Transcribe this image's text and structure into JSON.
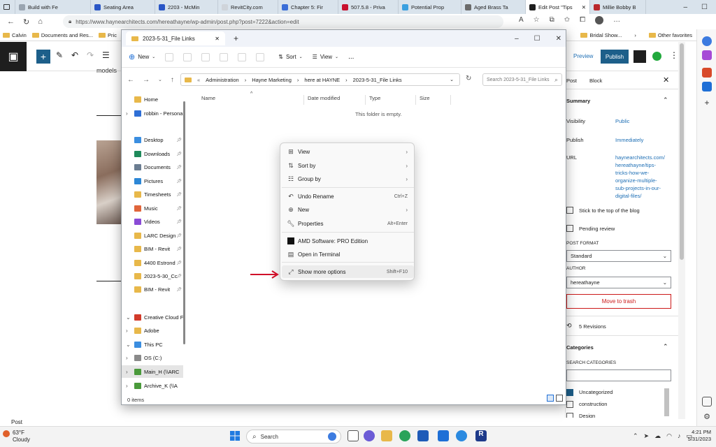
{
  "browser": {
    "tabs": [
      {
        "label": "Build with Fe",
        "color": "#9aa5b1",
        "active": false
      },
      {
        "label": "Seating Area",
        "color": "#2a56c6",
        "active": false
      },
      {
        "label": "2203 - McMin",
        "color": "#2a56c6",
        "active": false
      },
      {
        "label": "RevitCity.com",
        "color": "#cfd4da",
        "active": false
      },
      {
        "label": "Chapter 5: Fir",
        "color": "#3a6ed8",
        "active": false
      },
      {
        "label": "507.5.8 - Priva",
        "color": "#c8102e",
        "active": false
      },
      {
        "label": "Potential Prop",
        "color": "#3aa0e0",
        "active": false
      },
      {
        "label": "Aged Brass Ta",
        "color": "#6b6b6b",
        "active": false
      },
      {
        "label": "Edit Post \"Tips",
        "color": "#1e1e1e",
        "active": true
      },
      {
        "label": "Millie Bobby B",
        "color": "#b9272c",
        "active": false
      }
    ],
    "url": "https://www.haynearchitects.com/hereathayne/wp-admin/post.php?post=7222&action=edit",
    "favorites": [
      {
        "label": "Calvin",
        "icon": "folder-icon"
      },
      {
        "label": "Documents and Res...",
        "icon": "folder-icon"
      },
      {
        "label": "Pric",
        "icon": "folder-icon"
      }
    ],
    "favorites_right": [
      "Bridal Show...",
      "Other favorites"
    ],
    "status_text": "Post"
  },
  "wp": {
    "content_text": "models",
    "preview": "Preview",
    "publish": "Publish",
    "tabs": [
      "Post",
      "Block"
    ],
    "summary_title": "Summary",
    "visibility_label": "Visibility",
    "visibility_value": "Public",
    "publish_label": "Publish",
    "publish_value": "Immediately",
    "url_label": "URL",
    "url_value": "haynearchitects.com/hereathayne/tips-tricks-how-we-organize-multiple-sub-projects-in-our-digital-files/",
    "url_lines": [
      "haynearchitects.com/",
      "hereathayne/tips-",
      "tricks-how-we-",
      "organize-multiple-",
      "sub-projects-in-our-",
      "digital-files/"
    ],
    "sticky": "Stick to the top of the blog",
    "pending": "Pending review",
    "post_format_label": "POST FORMAT",
    "post_format_value": "Standard",
    "author_label": "AUTHOR",
    "author_value": "hereathayne",
    "trash": "Move to trash",
    "revisions": "5 Revisions",
    "categories_title": "Categories",
    "search_categories": "SEARCH CATEGORIES",
    "categories": [
      {
        "label": "Uncategorized",
        "checked": true
      },
      {
        "label": "construction",
        "checked": false
      },
      {
        "label": "Design",
        "checked": false
      }
    ]
  },
  "explorer": {
    "tab_title": "2023-5-31_File Links",
    "new": "New",
    "sort": "Sort",
    "view": "View",
    "more": "...",
    "breadcrumb": [
      "Administration",
      "Hayne Marketing",
      "here at HAYNE",
      "2023-5-31_File Links"
    ],
    "search_placeholder": "Search 2023-5-31_File Links",
    "columns": [
      "Name",
      "Date modified",
      "Type",
      "Size"
    ],
    "empty": "This folder is empty.",
    "status": "0 items",
    "nav": [
      {
        "label": "Home",
        "icon": "home-icon",
        "color": "#e8b84a",
        "chev": "",
        "pin": false
      },
      {
        "label": "robbin - Personal",
        "icon": "onedrive-icon",
        "color": "#2f6fd6",
        "chev": ">",
        "pin": false
      },
      {
        "label": "Desktop",
        "icon": "desktop-icon",
        "color": "#3b8ee0",
        "chev": "",
        "pin": true
      },
      {
        "label": "Downloads",
        "icon": "download-icon",
        "color": "#1f8a5b",
        "chev": "",
        "pin": true
      },
      {
        "label": "Documents",
        "icon": "documents-icon",
        "color": "#6b7d91",
        "chev": "",
        "pin": true
      },
      {
        "label": "Pictures",
        "icon": "pictures-icon",
        "color": "#2c87d6",
        "chev": "",
        "pin": true
      },
      {
        "label": "Timesheets",
        "icon": "folder-icon",
        "color": "#e8b84a",
        "chev": "",
        "pin": true
      },
      {
        "label": "Music",
        "icon": "music-icon",
        "color": "#e0653b",
        "chev": "",
        "pin": true
      },
      {
        "label": "Videos",
        "icon": "videos-icon",
        "color": "#8a4bd6",
        "chev": "",
        "pin": true
      },
      {
        "label": "LARC Design",
        "icon": "folder-icon",
        "color": "#e8b84a",
        "chev": "",
        "pin": true
      },
      {
        "label": "BIM - Revit",
        "icon": "folder-icon",
        "color": "#e8b84a",
        "chev": "",
        "pin": true
      },
      {
        "label": "4400 Estrond",
        "icon": "folder-icon",
        "color": "#e8b84a",
        "chev": "",
        "pin": true
      },
      {
        "label": "2023-5-30_Cc",
        "icon": "folder-icon",
        "color": "#e8b84a",
        "chev": "",
        "pin": true
      },
      {
        "label": "BIM - Revit",
        "icon": "folder-icon",
        "color": "#e8b84a",
        "chev": "",
        "pin": true
      },
      {
        "label": "Creative Cloud F",
        "icon": "creative-cloud-icon",
        "color": "#d23b2a",
        "chev": "v",
        "pin": false
      },
      {
        "label": "Adobe",
        "icon": "folder-icon",
        "color": "#e8b84a",
        "chev": ">",
        "pin": false
      },
      {
        "label": "This PC",
        "icon": "pc-icon",
        "color": "#3b8ee0",
        "chev": "v",
        "pin": false
      },
      {
        "label": "OS (C:)",
        "icon": "drive-icon",
        "color": "#8a8a8a",
        "chev": ">",
        "pin": false
      },
      {
        "label": "Main_H (\\\\ARC",
        "icon": "network-drive-icon",
        "color": "#4a9a3b",
        "chev": ">",
        "pin": false
      },
      {
        "label": "Archive_K (\\\\A",
        "icon": "network-drive-icon",
        "color": "#4a9a3b",
        "chev": ">",
        "pin": false
      }
    ]
  },
  "context_menu": {
    "items": [
      {
        "label": "View",
        "icon": "grid-icon",
        "shortcut": "",
        "submenu": true
      },
      {
        "label": "Sort by",
        "icon": "sort-icon",
        "shortcut": "",
        "submenu": true
      },
      {
        "label": "Group by",
        "icon": "group-icon",
        "shortcut": "",
        "submenu": true
      },
      {
        "label": "Undo Rename",
        "icon": "undo-icon",
        "shortcut": "Ctrl+Z",
        "submenu": false
      },
      {
        "label": "New",
        "icon": "new-icon",
        "shortcut": "",
        "submenu": true
      },
      {
        "label": "Properties",
        "icon": "wrench-icon",
        "shortcut": "Alt+Enter",
        "submenu": false
      },
      {
        "label": "AMD Software: PRO Edition",
        "icon": "amd-icon",
        "shortcut": "",
        "submenu": false
      },
      {
        "label": "Open in Terminal",
        "icon": "terminal-icon",
        "shortcut": "",
        "submenu": false
      },
      {
        "label": "Show more options",
        "icon": "expand-icon",
        "shortcut": "Shift+F10",
        "submenu": false
      }
    ]
  },
  "taskbar": {
    "temperature": "63°F",
    "weather": "Cloudy",
    "search": "Search",
    "time": "4:21 PM",
    "date": "5/31/2023"
  },
  "colors": {
    "accent": "#1d5f8a",
    "link": "#1e6fb5",
    "danger": "#cc1818",
    "arrow": "#d0102a"
  }
}
